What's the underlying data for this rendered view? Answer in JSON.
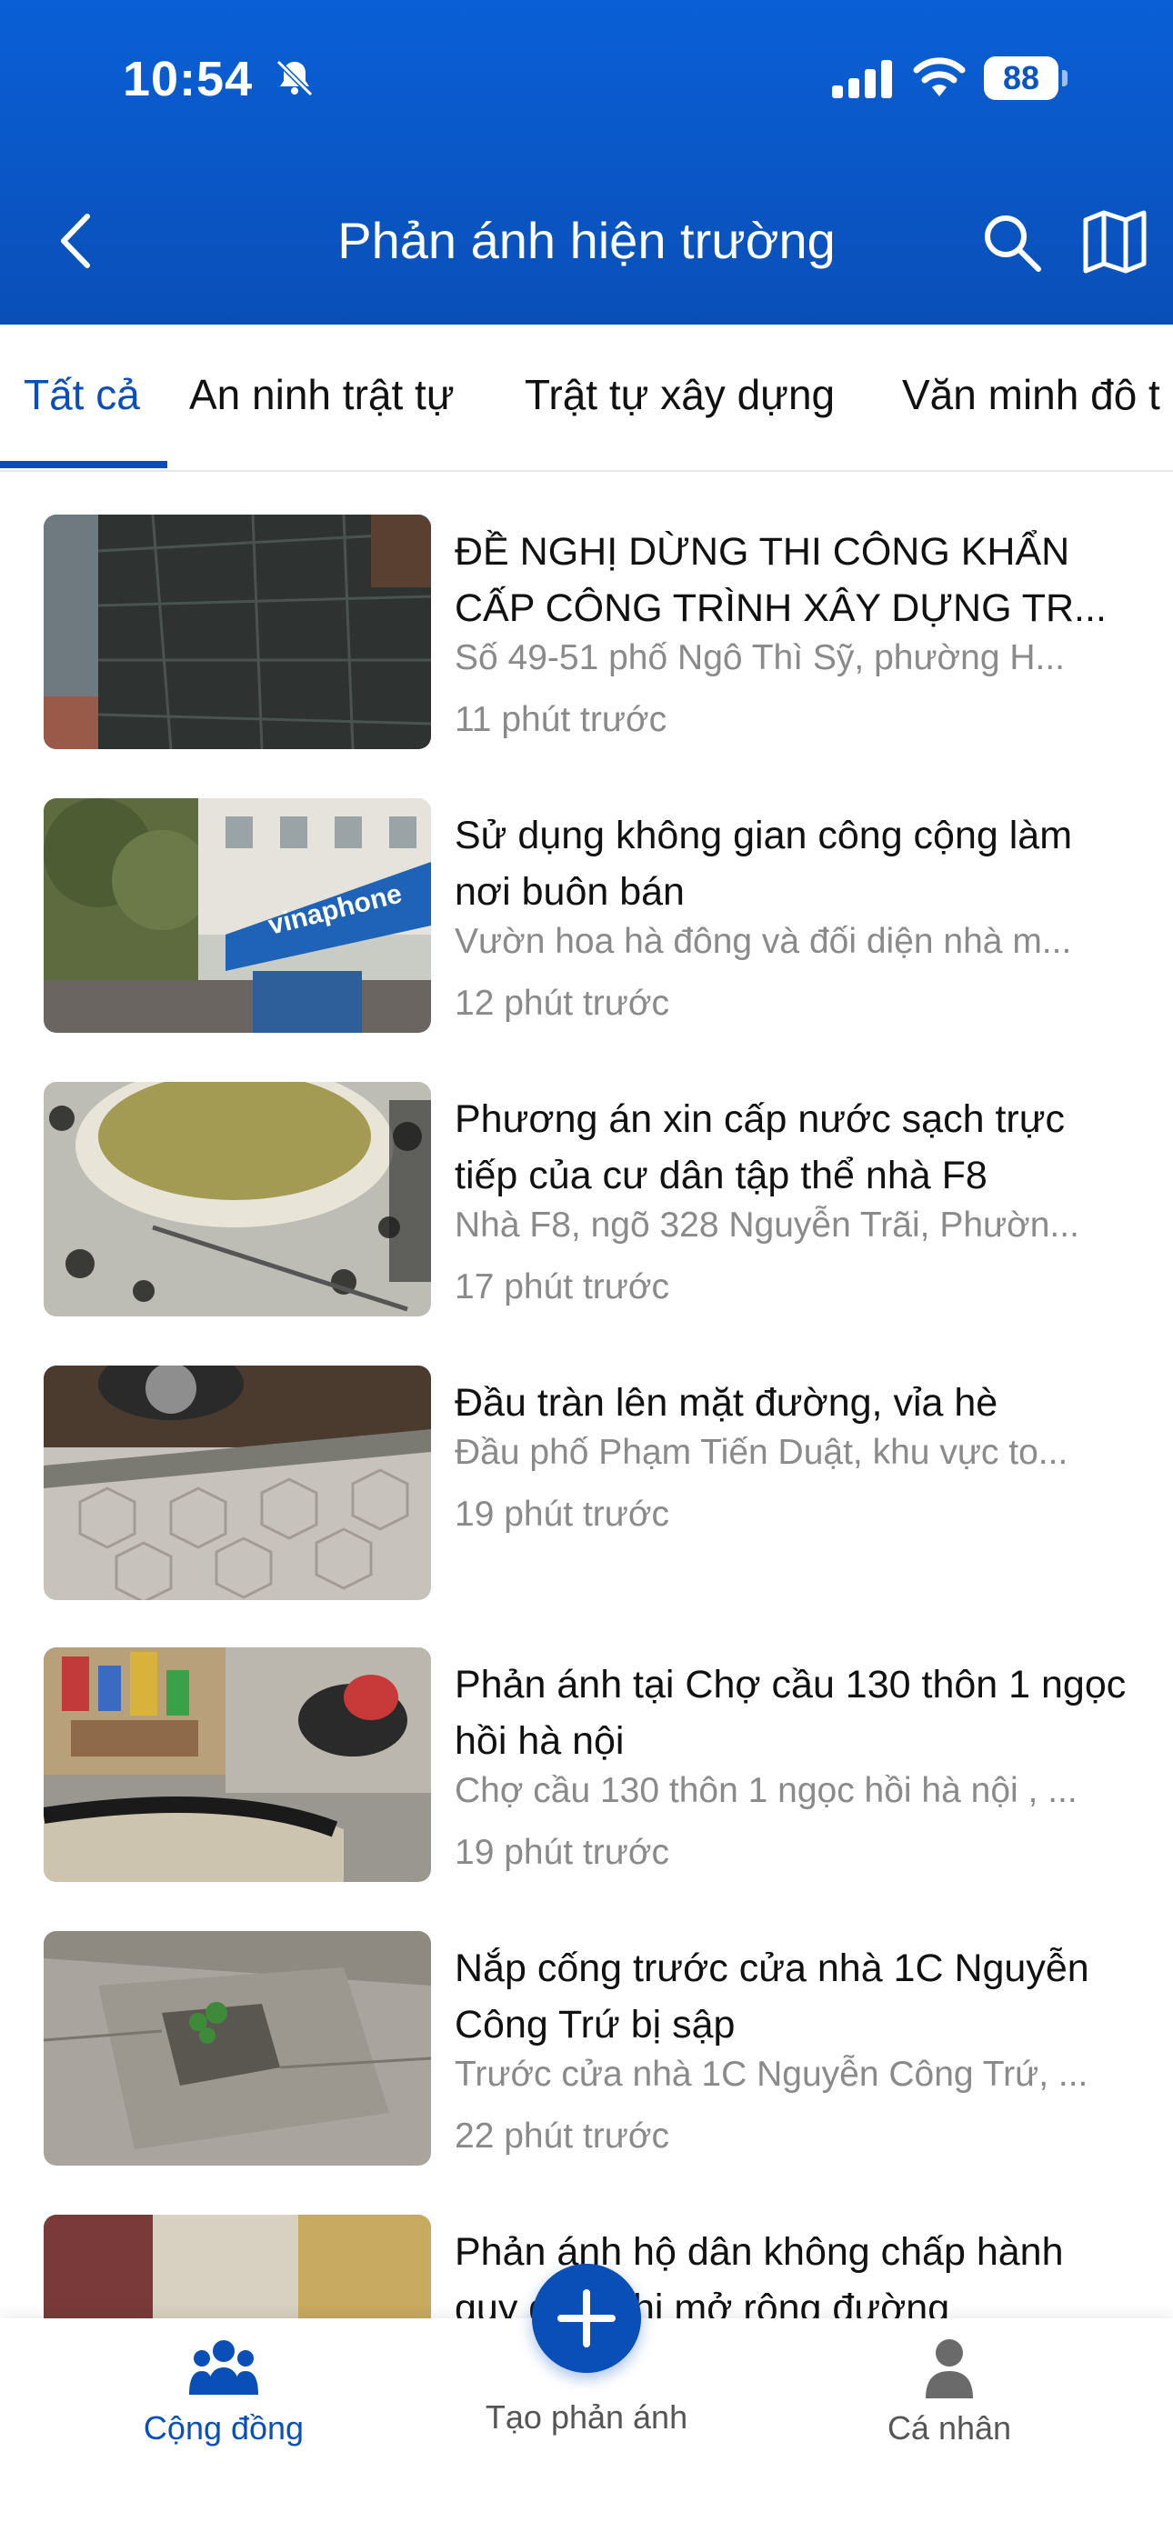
{
  "status": {
    "time": "10:54",
    "battery": "88"
  },
  "header": {
    "title": "Phản ánh hiện trường"
  },
  "tabs": [
    {
      "label": "Tất cả"
    },
    {
      "label": "An ninh trật tự"
    },
    {
      "label": "Trật tự xây dựng"
    },
    {
      "label": "Văn minh đô t"
    }
  ],
  "items": [
    {
      "title": "ĐỀ NGHỊ DỪNG THI CÔNG KHẨN CẤP CÔNG TRÌNH XÂY DỰNG TR...",
      "address": "Số 49-51 phố Ngô Thì Sỹ, phường H...",
      "time": "11 phút trước"
    },
    {
      "title": "Sử dụng không gian công cộng làm nơi buôn bán",
      "address": "Vườn hoa hà đông và đối diện nhà m...",
      "time": "12 phút trước"
    },
    {
      "title": "Phương án xin cấp nước sạch trực tiếp của cư dân tập thể nhà F8",
      "address": "Nhà F8, ngõ 328 Nguyễn Trãi, Phườn...",
      "time": "17 phút trước"
    },
    {
      "title": "Đầu tràn lên mặt đường, vỉa hè",
      "address": "Đầu phố Phạm Tiến Duật, khu vực to...",
      "time": "19 phút trước"
    },
    {
      "title": "Phản ánh tại Chợ cầu 130 thôn 1 ngọc hồi hà nội",
      "address": "Chợ cầu 130 thôn 1 ngọc hồi hà nội , ...",
      "time": "19 phút trước"
    },
    {
      "title": "Nắp cống trước cửa nhà 1C Nguyễn Công Trứ bị sập",
      "address": "Trước cửa nhà 1C Nguyễn Công Trứ, ...",
      "time": "22 phút trước"
    },
    {
      "title": "Phản ánh hộ dân không chấp hành quy định khi mở rộng đường",
      "address": "",
      "time": ""
    }
  ],
  "bottom_nav": {
    "community": "Cộng đồng",
    "create": "Tạo phản ánh",
    "profile": "Cá nhân"
  },
  "colors": {
    "primary": "#0a4fb8",
    "header_top": "#0a5fd6",
    "muted_text": "#8a8a8a"
  }
}
